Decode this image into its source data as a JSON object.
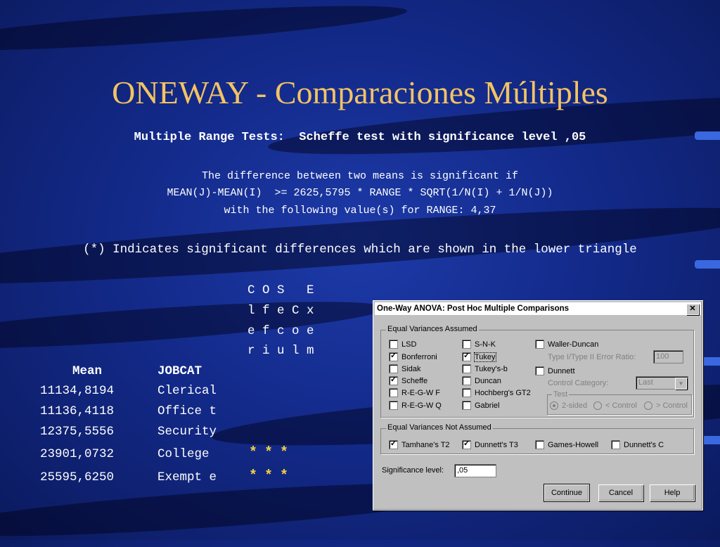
{
  "slide": {
    "title": "ONEWAY - Comparaciones Múltiples",
    "line1": "Multiple Range Tests:  Scheffe test with significance level ,05",
    "line2": "The difference between two means is significant if",
    "line3": "MEAN(J)-MEAN(I)  >= 2625,5795 * RANGE * SQRT(1/N(I) + 1/N(J))",
    "line4": "with the following value(s) for RANGE: 4,37",
    "line5": "(*) Indicates significant differences which are shown in the lower triangle",
    "col_headers": [
      "C O S   E",
      "l f e C x",
      "e f c o e",
      "r i u l m"
    ],
    "table_headers": {
      "mean": "Mean",
      "jobcat": "JOBCAT"
    },
    "rows": [
      {
        "mean": "11134,8194",
        "jobcat": "Clerical",
        "stars": ""
      },
      {
        "mean": "11136,4118",
        "jobcat": "Office t",
        "stars": ""
      },
      {
        "mean": "12375,5556",
        "jobcat": "Security",
        "stars": ""
      },
      {
        "mean": "23901,0732",
        "jobcat": "College",
        "stars": "***"
      },
      {
        "mean": "25595,6250",
        "jobcat": "Exempt e",
        "stars": "***"
      }
    ]
  },
  "dialog": {
    "title": "One-Way ANOVA: Post Hoc Multiple Comparisons",
    "close": "✕",
    "group1_label": "Equal Variances Assumed",
    "group2_label": "Equal Variances Not Assumed",
    "test_label": "Test",
    "lsd": "LSD",
    "bonferroni": "Bonferroni",
    "sidak": "Sidak",
    "scheffe": "Scheffe",
    "regwf": "R-E-G-W F",
    "regwq": "R-E-G-W Q",
    "snk": "S-N-K",
    "tukey": "Tukey",
    "tukeysb": "Tukey's-b",
    "duncan": "Duncan",
    "hochberg": "Hochberg's GT2",
    "gabriel": "Gabriel",
    "waller": "Waller-Duncan",
    "ratio_label": "Type I/Type II Error Ratio:",
    "ratio_value": "100",
    "dunnett": "Dunnett",
    "control_label": "Control Category:",
    "control_value": "Last",
    "two_sided": "2-sided",
    "lt_control": "< Control",
    "gt_control": "> Control",
    "tamhane": "Tamhane's T2",
    "dunnett_t3": "Dunnett's T3",
    "games": "Games-Howell",
    "dunnett_c": "Dunnett's C",
    "sig_label": "Significance level:",
    "sig_value": ",05",
    "continue": "Continue",
    "cancel": "Cancel",
    "help": "Help"
  }
}
